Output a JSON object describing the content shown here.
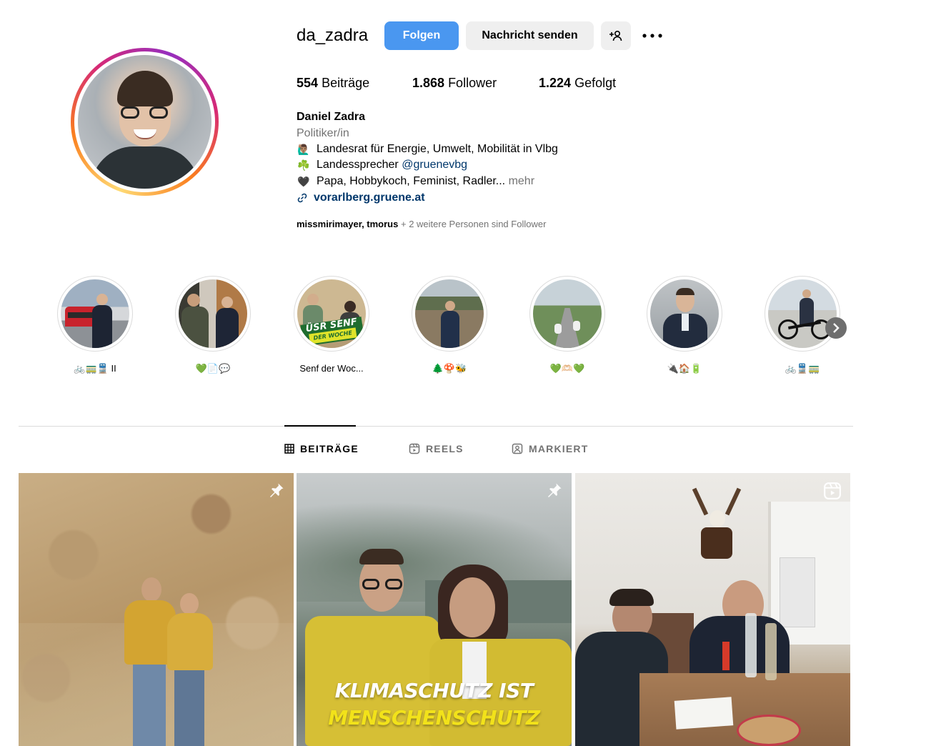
{
  "profile": {
    "username": "da_zadra",
    "follow_label": "Folgen",
    "message_label": "Nachricht senden",
    "add_person_icon": "add-person-icon",
    "more_icon": "more-horizontal-icon"
  },
  "stats": {
    "posts_count": "554",
    "posts_label": "Beiträge",
    "followers_count": "1.868",
    "followers_label": "Follower",
    "following_count": "1.224",
    "following_label": "Gefolgt"
  },
  "bio": {
    "name": "Daniel Zadra",
    "category": "Politiker/in",
    "line1_emoji": "🙋🏽‍♂️",
    "line1_text": "Landesrat für Energie, Umwelt, Mobilität in Vlbg",
    "line2_emoji": "☘️",
    "line2_text": "Landessprecher",
    "line2_mention": "@gruenevbg",
    "line3_emoji": "🖤",
    "line3_text": "Papa, Hobbykoch, Feminist, Radler...",
    "line3_more": "mehr",
    "link": "vorarlberg.gruene.at"
  },
  "followed_by": {
    "names": "missmirimayer, tmorus",
    "rest": "+ 2 weitere Personen sind Follower"
  },
  "highlights": [
    {
      "label": "🚲🚃🚆 II"
    },
    {
      "label": "💚📄💬"
    },
    {
      "label": "Senf der Woc..."
    },
    {
      "label": "🌲🍄🐝"
    },
    {
      "label": "💚🫶🏻💚"
    },
    {
      "label": "🔌🏠🔋"
    },
    {
      "label": "🚲🚆🚃"
    }
  ],
  "highlight_badge": {
    "line1": "ÜSR SENF",
    "line2": "DER WOCHE"
  },
  "tabs": [
    {
      "label": "BEITRÄGE",
      "icon": "grid-icon",
      "active": true
    },
    {
      "label": "REELS",
      "icon": "reels-icon",
      "active": false
    },
    {
      "label": "MARKIERT",
      "icon": "tagged-icon",
      "active": false
    }
  ],
  "posts": [
    {
      "badge_icon": "pin-icon"
    },
    {
      "badge_icon": "pin-icon",
      "overlay_line1": "KLIMASCHUTZ IST",
      "overlay_line2": "MENSCHENSCHUTZ"
    },
    {
      "badge_icon": "reel-icon"
    }
  ],
  "colors": {
    "accent_blue": "#4a97f0",
    "link_blue": "#00376b",
    "muted": "#737373",
    "overlay_yellow": "#f2e21a"
  }
}
